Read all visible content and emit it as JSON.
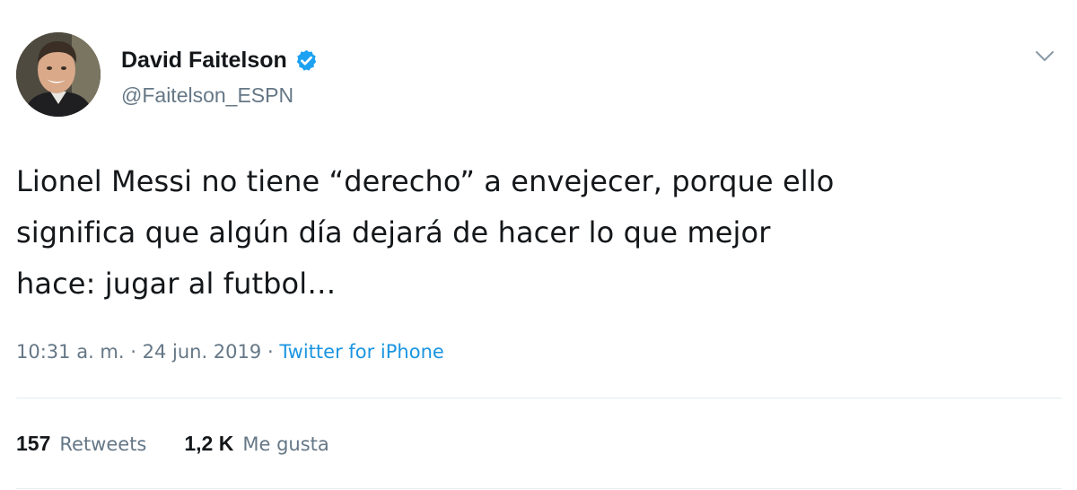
{
  "author": {
    "display_name": "David Faitelson",
    "handle": "@Faitelson_ESPN",
    "verified": true,
    "avatar_icon": "avatar-photo"
  },
  "tweet": {
    "text": "Lionel Messi no tiene “derecho” a envejecer, porque ello\nsignifica que algún día dejará de hacer lo que mejor\nhace: jugar al futbol…",
    "time": "10:31 a. m.",
    "separator": "·",
    "date": "24 jun. 2019",
    "source": "Twitter for iPhone"
  },
  "stats": {
    "retweets_count": "157",
    "retweets_label": "Retweets",
    "likes_count": "1,2 K",
    "likes_label": "Me gusta"
  },
  "icons": {
    "verified": "verified-badge-icon",
    "menu": "chevron-down-icon"
  },
  "colors": {
    "text": "#14171a",
    "secondary": "#657786",
    "link": "#1b95e0",
    "verified": "#1da1f2",
    "divider": "#e6ecf0"
  }
}
